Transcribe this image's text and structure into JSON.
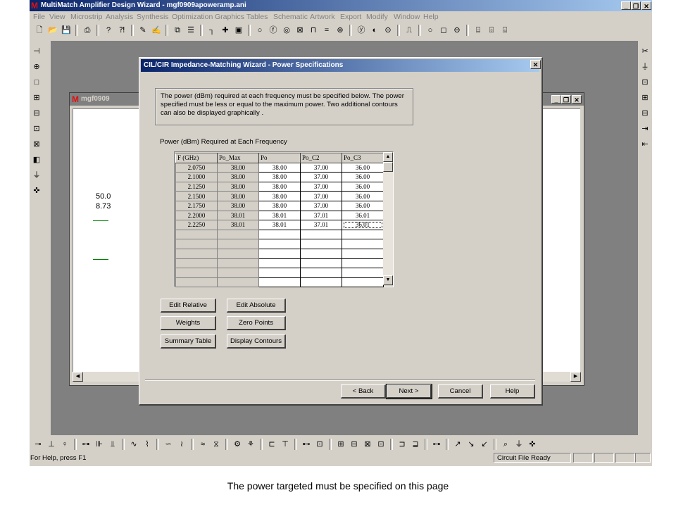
{
  "app": {
    "title": "MultiMatch Amplifier Design Wizard - mgf0909apoweramp.ani",
    "logo": "M",
    "menus": [
      "File",
      "View",
      "Microstrip",
      "Analysis",
      "Synthesis",
      "Optimization",
      "Graphics",
      "Tables",
      "Schematic",
      "Artwork",
      "Export",
      "Modify",
      "Window",
      "Help"
    ],
    "caption_buttons": {
      "minimize": "_",
      "restore": "❐",
      "close": "✕"
    }
  },
  "mdi": {
    "title": "mgf0909",
    "canvas_text_1": "50.0",
    "canvas_text_2": "8.73"
  },
  "wizard": {
    "title": "CIL/CIR Impedance-Matching Wizard - Power Specifications",
    "description": "The power (dBm) required at each frequency must be specified below. The power specified must be less or equal to the maximum power. Two additional contours can also be displayed graphically .",
    "grid_caption": "Power (dBm) Required at Each Frequency",
    "grid": {
      "headers": [
        "F (GHz)",
        "Po_Max",
        "Po",
        "Po_C2",
        "Po_C3"
      ],
      "rows": [
        [
          "2.0750",
          "38.00",
          "38.00",
          "37.00",
          "36.00"
        ],
        [
          "2.1000",
          "38.00",
          "38.00",
          "37.00",
          "36.00"
        ],
        [
          "2.1250",
          "38.00",
          "38.00",
          "37.00",
          "36.00"
        ],
        [
          "2.1500",
          "38.00",
          "38.00",
          "37.00",
          "36.00"
        ],
        [
          "2.1750",
          "38.00",
          "38.00",
          "37.00",
          "36.00"
        ],
        [
          "2.2000",
          "38.01",
          "38.01",
          "37.01",
          "36.01"
        ],
        [
          "2.2250",
          "38.01",
          "38.01",
          "37.01",
          "36.01"
        ]
      ]
    },
    "buttons": {
      "edit_relative": "Edit Relative",
      "edit_absolute": "Edit Absolute",
      "weights": "Weights",
      "zero_points": "Zero Points",
      "summary_table": "Summary Table",
      "display_contours": "Display Contours",
      "back": "< Back",
      "next": "Next >",
      "cancel": "Cancel",
      "help": "Help"
    }
  },
  "status": {
    "left": "For Help, press F1",
    "right": "Circuit File Ready"
  },
  "caption": "The power targeted must be specified on this page"
}
